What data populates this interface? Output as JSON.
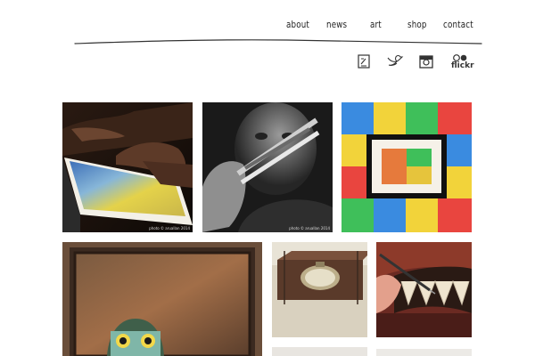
{
  "nav": {
    "items": [
      {
        "label": "about"
      },
      {
        "label": "news"
      },
      {
        "label": "art"
      },
      {
        "label": "shop"
      },
      {
        "label": "contact"
      }
    ]
  },
  "social": [
    {
      "icon": "blog-icon"
    },
    {
      "icon": "twitter-icon"
    },
    {
      "icon": "instagram-icon"
    },
    {
      "icon": "flickr-icon"
    }
  ],
  "social_text": {
    "flickr_label": "flickr"
  },
  "gallery": {
    "photo_credit_1": "photo © aruallan 2014",
    "photo_credit_2": "photo © aruallan 2014"
  },
  "colors": {
    "text": "#222222",
    "background": "#ffffff"
  }
}
